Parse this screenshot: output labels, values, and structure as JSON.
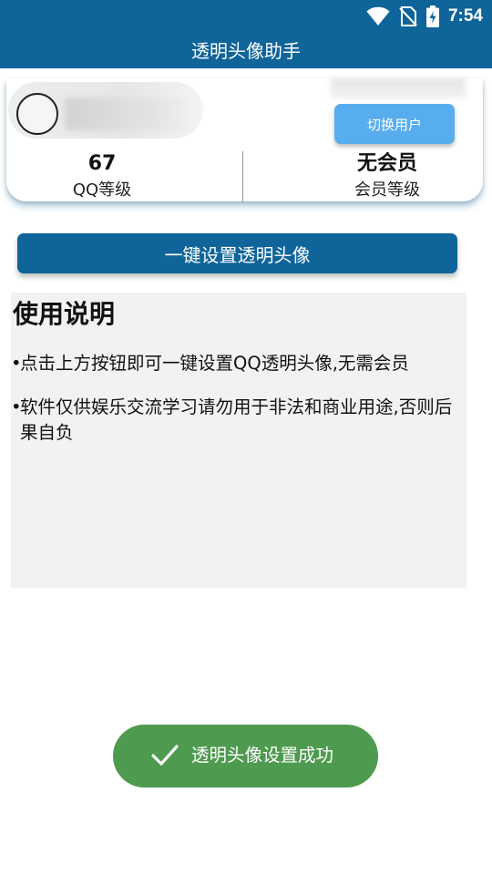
{
  "status_bar": {
    "time": "7:54",
    "icons": [
      "wifi-icon",
      "no-sim-icon",
      "battery-charging-icon"
    ]
  },
  "app_bar": {
    "title": "透明头像助手"
  },
  "profile": {
    "switch_user_label": "切换用户",
    "qq_level_value": "67",
    "qq_level_label": "QQ等级",
    "vip_value": "无会员",
    "vip_label": "会员等级"
  },
  "actions": {
    "set_transparent_avatar_label": "一键设置透明头像"
  },
  "instructions": {
    "title": "使用说明",
    "bullet_symbol": "•",
    "items": [
      "点击上方按钮即可一键设置QQ透明头像,无需会员",
      "软件仅供娱乐交流学习请勿用于非法和商业用途,否则后果自负"
    ]
  },
  "toast": {
    "icon": "check-icon",
    "message": "透明头像设置成功"
  },
  "colors": {
    "primary": "#0f6499",
    "accent_button": "#57adee",
    "toast_bg": "#4e9a4f",
    "panel_bg": "#f2f2f2"
  }
}
